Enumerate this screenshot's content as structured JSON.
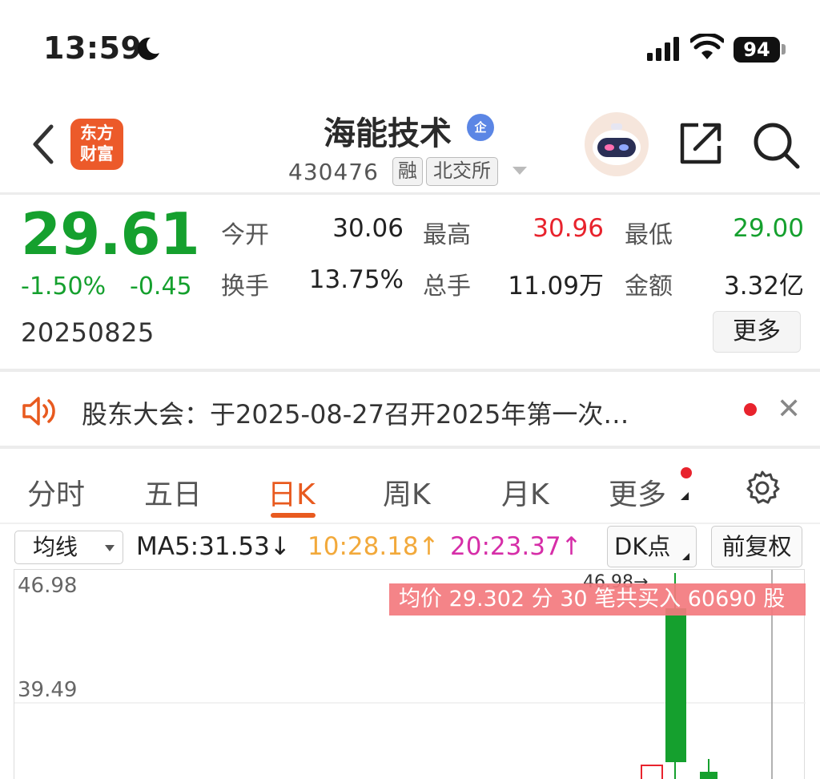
{
  "status_bar": {
    "time": "13:59",
    "battery": "94"
  },
  "header": {
    "logo_line1": "东方",
    "logo_line2": "财富",
    "stock_name": "海能技术",
    "verified_badge": "企",
    "stock_code": "430476",
    "tag_margin": "融",
    "tag_exchange": "北交所"
  },
  "quote": {
    "price": "29.61",
    "change_pct": "-1.50%",
    "change_abs": "-0.45",
    "date": "20250825",
    "fields": {
      "open_label": "今开",
      "open": "30.06",
      "high_label": "最高",
      "high": "30.96",
      "low_label": "最低",
      "low": "29.00",
      "turnover_label": "换手",
      "turnover": "13.75%",
      "volume_label": "总手",
      "volume": "11.09万",
      "amount_label": "金额",
      "amount": "3.32亿"
    },
    "more_label": "更多"
  },
  "announcement": {
    "text": "股东大会：于2025-08-27召开2025年第一次…"
  },
  "tabs": [
    "分时",
    "五日",
    "日K",
    "周K",
    "月K",
    "更多"
  ],
  "active_tab": "日K",
  "chart_toolbar": {
    "ma_select": "均线",
    "ma5": "MA5:31.53↓",
    "ma10": "10:28.18↑",
    "ma20": "20:23.37↑",
    "dk_button": "DK点",
    "adjust_button": "前复权"
  },
  "colors": {
    "up": "#e8232d",
    "down": "#15a02e",
    "accent": "#e85a1f",
    "ma10": "#f2a93b",
    "ma20": "#d62ea8"
  },
  "chart": {
    "y_top": "46.98",
    "y_mid": "39.49",
    "high_marker": "46.98→",
    "banner": "均价 29.302 分 30 笔共买入 60690 股"
  }
}
